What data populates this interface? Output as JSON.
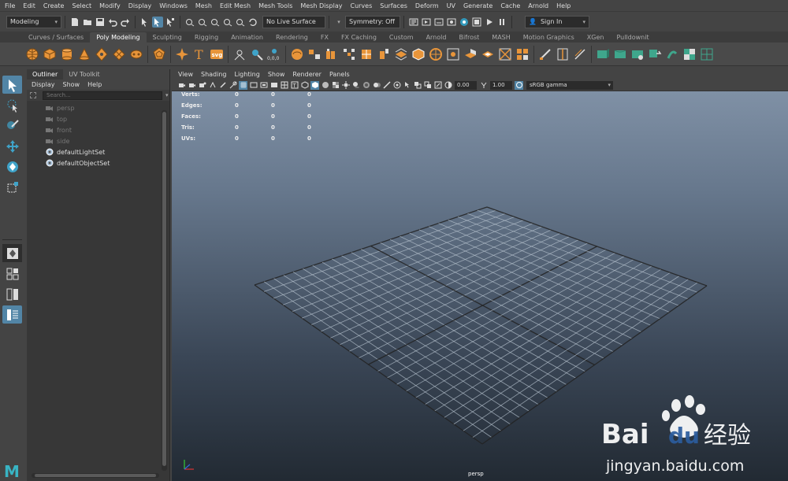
{
  "menubar": [
    "File",
    "Edit",
    "Create",
    "Select",
    "Modify",
    "Display",
    "Windows",
    "Mesh",
    "Edit Mesh",
    "Mesh Tools",
    "Mesh Display",
    "Curves",
    "Surfaces",
    "Deform",
    "UV",
    "Generate",
    "Cache",
    "Arnold",
    "Help"
  ],
  "statusline": {
    "mode": "Modeling",
    "live_surface": "No Live Surface",
    "symmetry": "Symmetry: Off",
    "sign_in": "Sign In"
  },
  "shelf_tabs": [
    "Curves / Surfaces",
    "Poly Modeling",
    "Sculpting",
    "Rigging",
    "Animation",
    "Rendering",
    "FX",
    "FX Caching",
    "Custom",
    "Arnold",
    "Bifrost",
    "MASH",
    "Motion Graphics",
    "XGen",
    "Pulldownit"
  ],
  "shelf_active": "Poly Modeling",
  "shelf_text_icons": {
    "type": "T",
    "svg": "svg",
    "param": "0,0,0"
  },
  "outliner": {
    "tabs": [
      "Outliner",
      "UV Toolkit"
    ],
    "menu": [
      "Display",
      "Show",
      "Help"
    ],
    "search_placeholder": "Search...",
    "items": [
      {
        "label": "persp",
        "dim": true,
        "icon": "camera-icon"
      },
      {
        "label": "top",
        "dim": true,
        "icon": "camera-icon"
      },
      {
        "label": "front",
        "dim": true,
        "icon": "camera-icon"
      },
      {
        "label": "side",
        "dim": true,
        "icon": "camera-icon"
      },
      {
        "label": "defaultLightSet",
        "dim": false,
        "icon": "set-icon"
      },
      {
        "label": "defaultObjectSet",
        "dim": false,
        "icon": "set-icon"
      }
    ]
  },
  "viewport": {
    "menu": [
      "View",
      "Shading",
      "Lighting",
      "Show",
      "Renderer",
      "Panels"
    ],
    "exposure": "0.00",
    "gamma": "1.00",
    "color_space": "sRGB gamma",
    "camera": "persp",
    "hud": [
      {
        "label": "Verts:",
        "values": [
          "0",
          "0",
          "0"
        ]
      },
      {
        "label": "Edges:",
        "values": [
          "0",
          "0",
          "0"
        ]
      },
      {
        "label": "Faces:",
        "values": [
          "0",
          "0",
          "0"
        ]
      },
      {
        "label": "Tris:",
        "values": [
          "0",
          "0",
          "0"
        ]
      },
      {
        "label": "UVs:",
        "values": [
          "0",
          "0",
          "0"
        ]
      }
    ]
  },
  "watermark": {
    "brand": "Bai",
    "brand2": "du",
    "cn": "经验",
    "url": "jingyan.baidu.com"
  },
  "logo_letter": "M",
  "colors": {
    "accent": "#5285a6",
    "shelf_orange": "#e8953a",
    "shelf_teal": "#3fa68c"
  }
}
